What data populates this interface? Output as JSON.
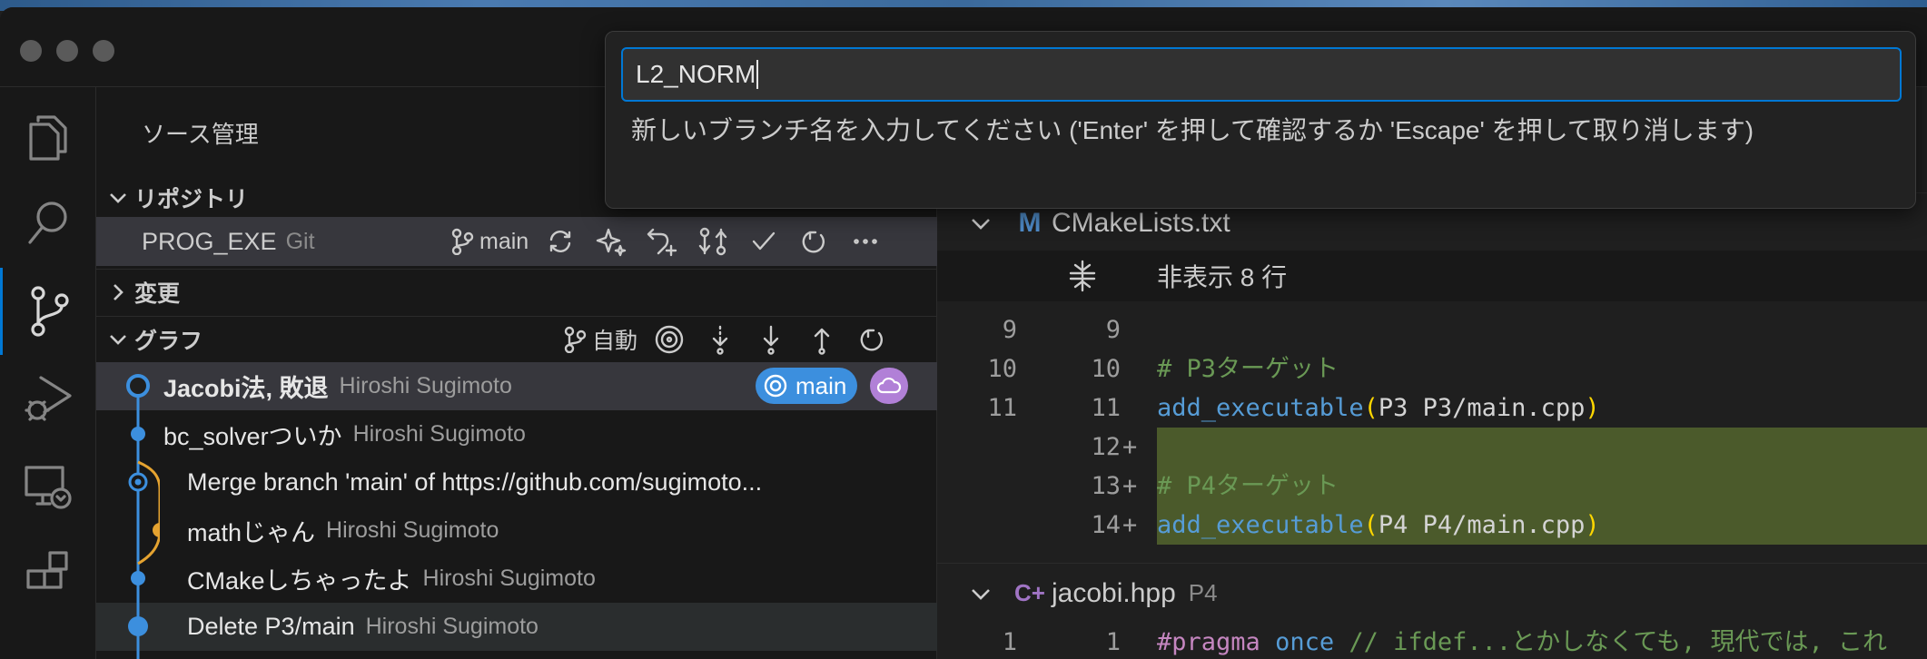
{
  "colors": {
    "accent": "#0078d4",
    "branch_badge": "#3c8fde",
    "cloud_badge": "#b180d7",
    "graph_blue": "#3c8fde",
    "graph_yellow": "#e5a330",
    "added_line_bg": "#4b5a2b"
  },
  "activity_bar": {
    "items": [
      {
        "name": "explorer",
        "icon": "files-icon"
      },
      {
        "name": "search",
        "icon": "search-icon"
      },
      {
        "name": "source-control",
        "icon": "source-control-icon",
        "active": true
      },
      {
        "name": "run-and-debug",
        "icon": "debug-icon"
      },
      {
        "name": "remote-explorer",
        "icon": "remote-explorer-icon"
      },
      {
        "name": "extensions",
        "icon": "extensions-icon"
      }
    ]
  },
  "sidebar": {
    "title": "ソース管理",
    "repositories_header": "リポジトリ",
    "repo": {
      "name": "PROG_EXE",
      "kind": "Git",
      "branch": "main"
    },
    "changes_header": "変更",
    "graph_header": "グラフ",
    "graph_scope": "自動",
    "commits": [
      {
        "message": "Jacobi法, 敗退",
        "author": "Hiroshi Sugimoto",
        "bold": true,
        "branch_badge": "main"
      },
      {
        "message": "bc_solverついか",
        "author": "Hiroshi Sugimoto"
      },
      {
        "message": "Merge branch 'main' of https://github.com/sugimoto...",
        "author": ""
      },
      {
        "message": "mathじゃん",
        "author": "Hiroshi Sugimoto"
      },
      {
        "message": "CMakeしちゃったよ",
        "author": "Hiroshi Sugimoto"
      },
      {
        "message": "Delete P3/main",
        "author": "Hiroshi Sugimoto"
      }
    ]
  },
  "quick_input": {
    "value": "L2_NORM",
    "message": "新しいブランチ名を入力してください ('Enter' を押して確認するか 'Escape' を押して取り消します)"
  },
  "editor": {
    "files": [
      {
        "name": "CMakeLists.txt",
        "dir": "",
        "icon": "cmake-icon",
        "icon_glyph": "M"
      },
      {
        "name": "jacobi.hpp",
        "dir": "P4",
        "icon": "cpp-header-icon",
        "icon_glyph": "C+"
      }
    ],
    "hidden_lines": "非表示 8 行",
    "lines": [
      {
        "old": "9",
        "new": "9",
        "marker": "",
        "segments": []
      },
      {
        "old": "10",
        "new": "10",
        "marker": "",
        "segments": [
          {
            "t": "# P3ターゲット",
            "c": "c-comment"
          }
        ]
      },
      {
        "old": "11",
        "new": "11",
        "marker": "",
        "segments": [
          {
            "t": "add_executable",
            "c": "c-fn"
          },
          {
            "t": "(",
            "c": "c-paren"
          },
          {
            "t": "P3 P3/main.cpp",
            "c": "c-plain"
          },
          {
            "t": ")",
            "c": "c-paren"
          }
        ]
      },
      {
        "old": "",
        "new": "12",
        "marker": "+",
        "added": true,
        "segments": []
      },
      {
        "old": "",
        "new": "13",
        "marker": "+",
        "added": true,
        "segments": [
          {
            "t": "# P4ターゲット",
            "c": "c-comment"
          }
        ]
      },
      {
        "old": "",
        "new": "14",
        "marker": "+",
        "added": true,
        "segments": [
          {
            "t": "add_executable",
            "c": "c-fn"
          },
          {
            "t": "(",
            "c": "c-paren"
          },
          {
            "t": "P4 P4/main.cpp",
            "c": "c-plain"
          },
          {
            "t": ")",
            "c": "c-paren"
          }
        ]
      }
    ],
    "jacobi_line": {
      "old": "1",
      "new": "1",
      "segments": [
        {
          "t": "#pragma",
          "c": "c-kw"
        },
        {
          "t": " ",
          "c": "c-plain"
        },
        {
          "t": "once",
          "c": "c-kw2"
        },
        {
          "t": " // ifdef...とかしなくても, 現代では, これ",
          "c": "c-comment"
        }
      ]
    }
  }
}
